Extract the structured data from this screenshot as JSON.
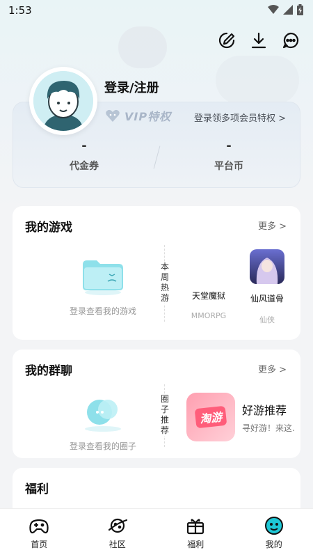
{
  "status_bar": {
    "time": "1:53"
  },
  "profile": {
    "login_title": "登录/注册"
  },
  "member": {
    "vip_label": "VIP特权",
    "vip_link": "登录领多项会员特权 >",
    "coupon_value": "-",
    "coupon_label": "代金券",
    "coin_value": "-",
    "coin_label": "平台币"
  },
  "my_games": {
    "title": "我的游戏",
    "more": "更多 >",
    "empty_text": "登录查看我的游戏",
    "side_label": [
      "本",
      "周",
      "热",
      "游"
    ],
    "games": [
      {
        "name": "天堂魔狱",
        "tag": "MMORPG"
      },
      {
        "name": "仙风道骨",
        "tag": "仙侠"
      }
    ]
  },
  "my_groups": {
    "title": "我的群聊",
    "more": "更多 >",
    "empty_text": "登录查看我的圈子",
    "side_label": [
      "圈",
      "子",
      "推",
      "荐"
    ],
    "recommend": {
      "name": "好游推荐",
      "desc": "寻好游！来这.",
      "badge": "淘游"
    }
  },
  "welfare": {
    "title": "福利"
  },
  "nav": {
    "items": [
      {
        "label": "首页",
        "icon": "gamepad-icon"
      },
      {
        "label": "社区",
        "icon": "planet-icon"
      },
      {
        "label": "福利",
        "icon": "gift-icon"
      },
      {
        "label": "我的",
        "icon": "smile-face-icon"
      }
    ]
  },
  "colors": {
    "accent": "#1ec8d6",
    "vip": "#a9b6c8"
  }
}
